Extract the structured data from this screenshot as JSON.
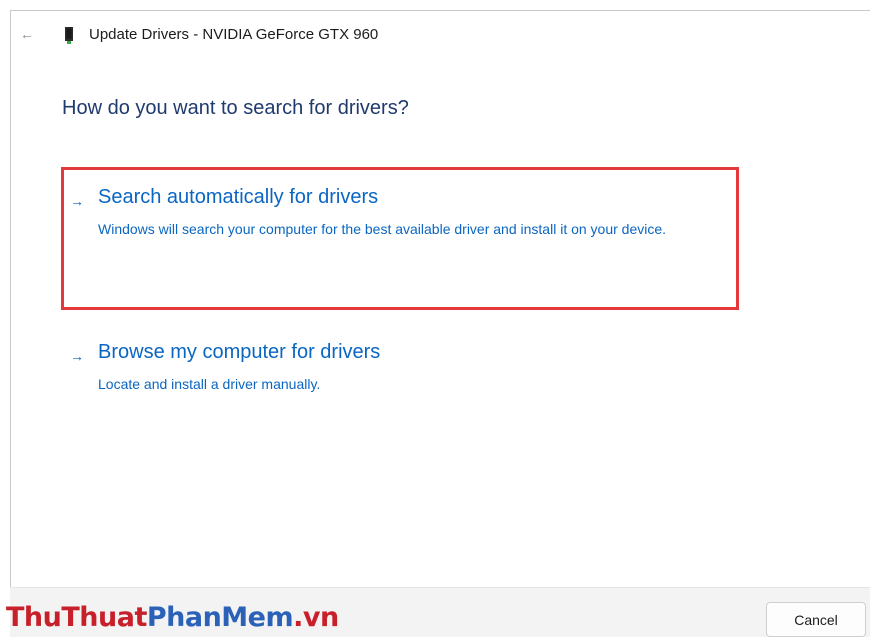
{
  "window": {
    "title": "Update Drivers - NVIDIA GeForce GTX 960",
    "back_icon": "←"
  },
  "main": {
    "question": "How do you want to search for drivers?",
    "options": [
      {
        "arrow": "→",
        "title": "Search automatically for drivers",
        "description": "Windows will search your computer for the best available driver and install it on your device.",
        "highlighted": true
      },
      {
        "arrow": "→",
        "title": "Browse my computer for drivers",
        "description": "Locate and install a driver manually.",
        "highlighted": false
      }
    ]
  },
  "footer": {
    "cancel_label": "Cancel"
  },
  "watermark": {
    "part1": "ThuThuat",
    "part2": "PhanMem",
    "part3": ".vn"
  },
  "colors": {
    "link_blue": "#0a66c2",
    "heading_blue": "#1f3a6d",
    "highlight_red": "#e5383b"
  }
}
